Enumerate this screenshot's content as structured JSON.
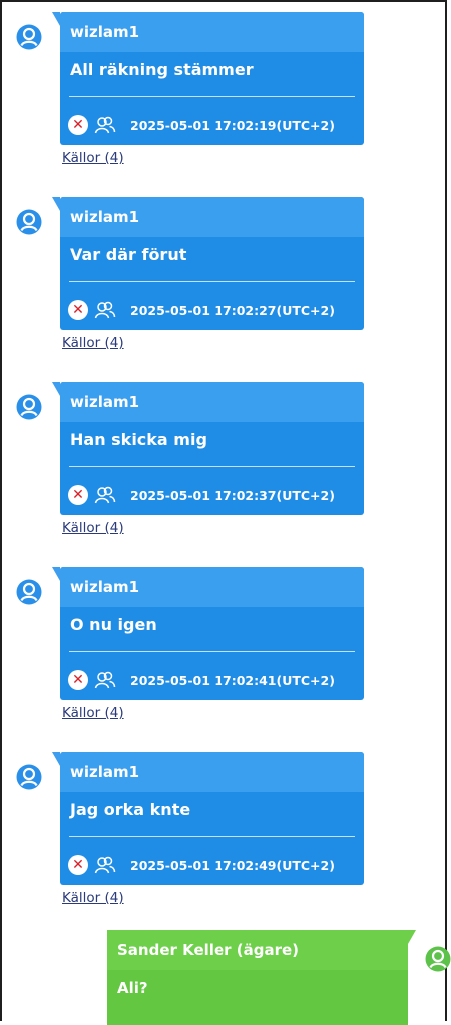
{
  "messages": [
    {
      "sender": "wizlam1",
      "text": "All räkning stämmer",
      "timestamp": "2025-05-01 17:02:19(UTC+2)",
      "sources": "Källor (4)"
    },
    {
      "sender": "wizlam1",
      "text": "Var där förut",
      "timestamp": "2025-05-01 17:02:27(UTC+2)",
      "sources": "Källor (4)"
    },
    {
      "sender": "wizlam1",
      "text": "Han skicka mig",
      "timestamp": "2025-05-01 17:02:37(UTC+2)",
      "sources": "Källor (4)"
    },
    {
      "sender": "wizlam1",
      "text": "O nu igen",
      "timestamp": "2025-05-01 17:02:41(UTC+2)",
      "sources": "Källor (4)"
    },
    {
      "sender": "wizlam1",
      "text": "Jag orka knte",
      "timestamp": "2025-05-01 17:02:49(UTC+2)",
      "sources": "Källor (4)"
    }
  ],
  "owner_message": {
    "sender": "Sander Keller (ägare)",
    "text": "Ali?"
  },
  "icons": {
    "avatar": "user-avatar-icon",
    "delete": "delete-x-icon",
    "group": "group-icon"
  },
  "colors": {
    "incoming_bubble": "#1f8ce6",
    "incoming_header": "#3b9ff0",
    "outgoing_bubble": "#63c742",
    "avatar_blue": "#2a8fe8",
    "avatar_green": "#5cc24a",
    "delete_red": "#d7222a"
  }
}
